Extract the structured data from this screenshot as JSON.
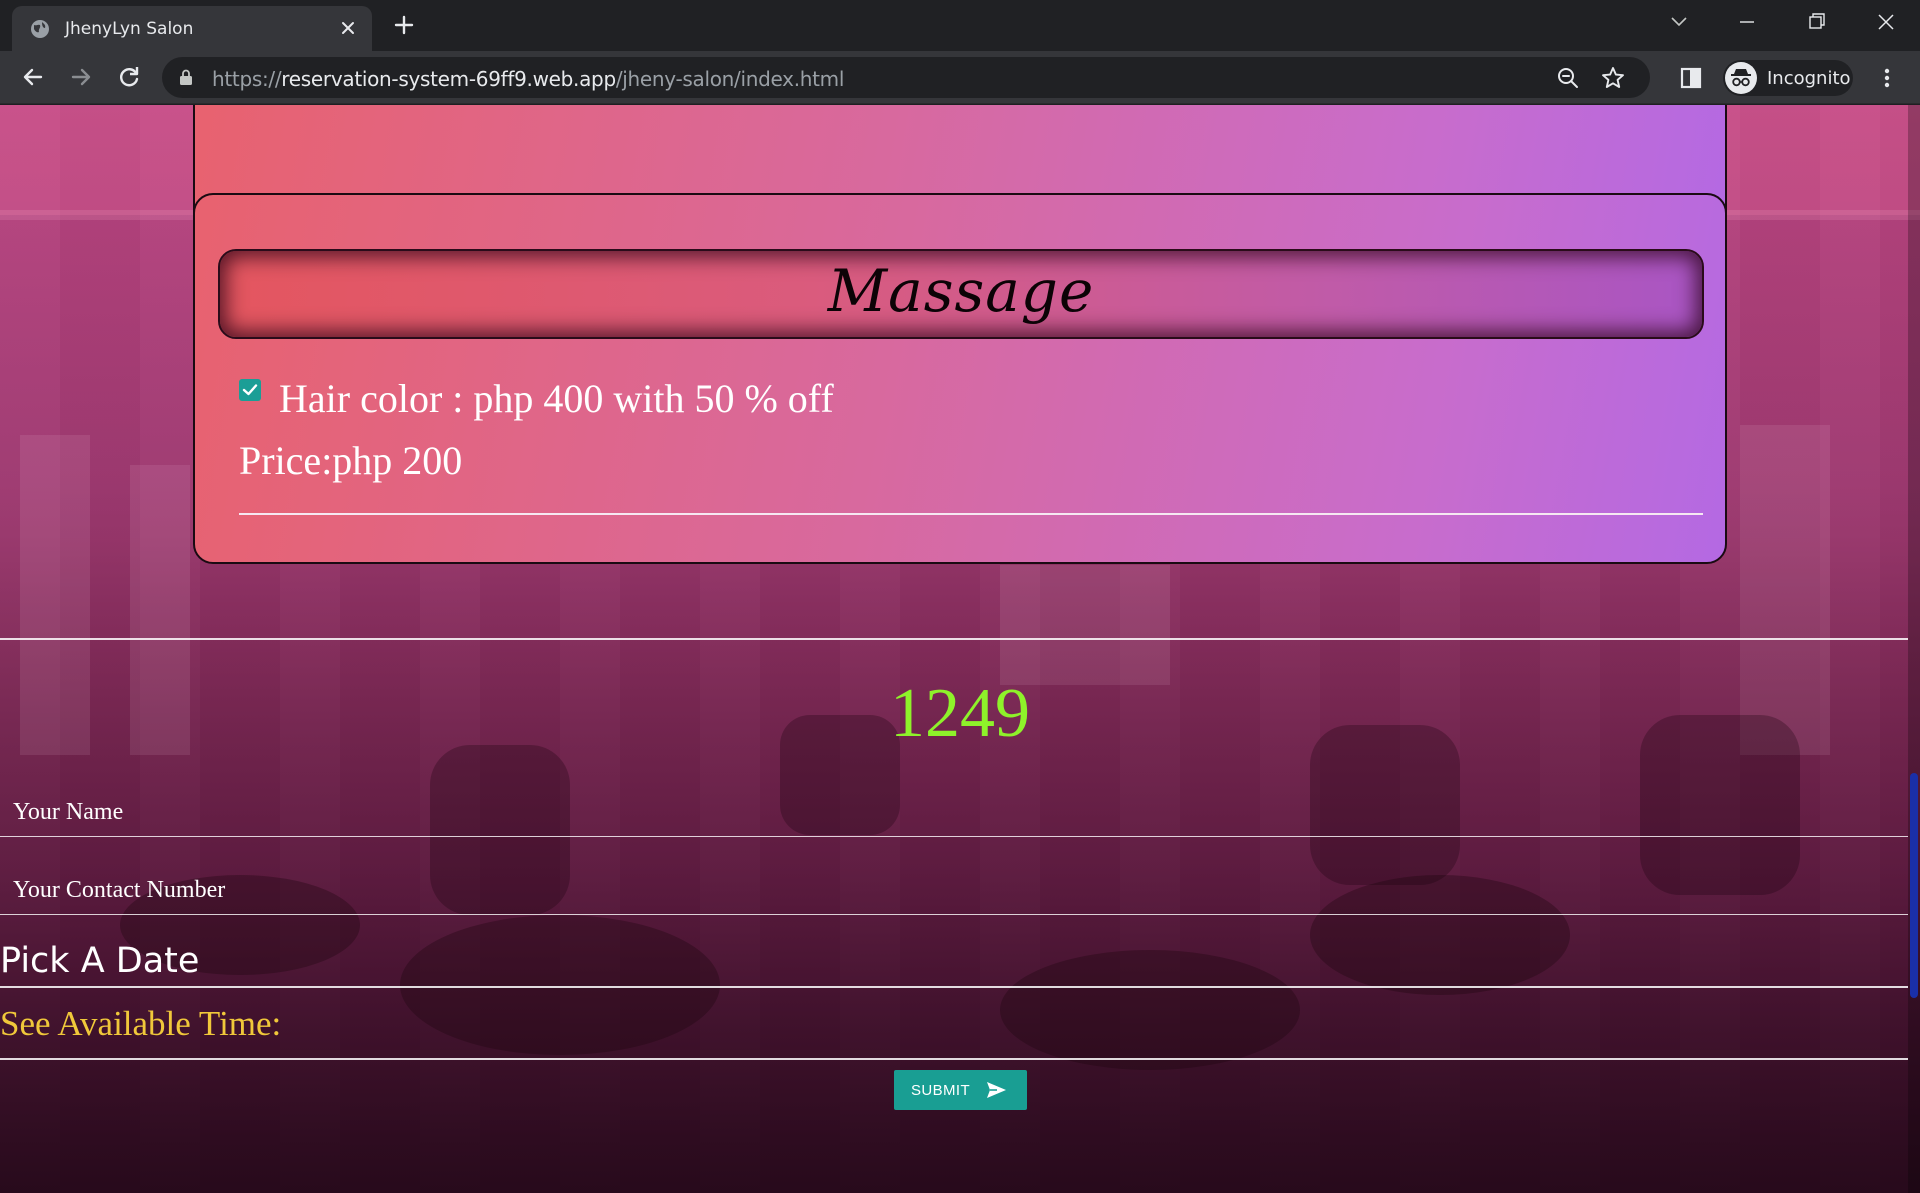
{
  "browser": {
    "tab_title": "JhenyLyn Salon",
    "url_scheme": "https://",
    "url_host": "reservation-system-69ff9.web.app",
    "url_path": "/jheny-salon/index.html",
    "profile_label": "Incognito",
    "icons": [
      "globe-icon",
      "close-icon",
      "plus-icon",
      "chevron-down-icon",
      "minimize-icon",
      "restore-icon",
      "close-window-icon",
      "back-arrow-icon",
      "forward-arrow-icon",
      "reload-icon",
      "lock-icon",
      "zoom-icon",
      "star-icon",
      "side-panel-icon",
      "incognito-icon",
      "kebab-menu-icon"
    ]
  },
  "massage_section": {
    "title": "Massage",
    "service_label": "Hair color : php 400 with 50 % off",
    "service_checked": true,
    "price_label": "Price:php 200"
  },
  "counter": "1249",
  "form": {
    "name_label": "Your Name",
    "contact_label": "Your Contact Number",
    "date_label": "Pick A Date",
    "time_label": "See Available Time:",
    "submit_label": "SUBMIT"
  },
  "colors": {
    "accent_teal": "#199e93",
    "counter_green": "#8ef22a",
    "time_label_gold": "#f0c83a",
    "scroll_thumb": "#1a2fa8"
  }
}
